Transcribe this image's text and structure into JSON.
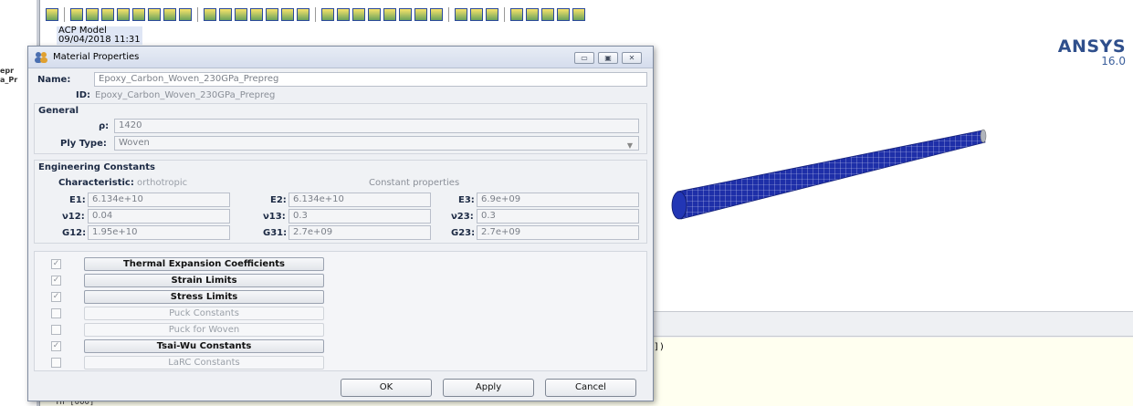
{
  "background": {
    "left_stub_lines": [
      "epr",
      "a_Pr"
    ],
    "viewport_info": {
      "model_name": "ACP Model",
      "timestamp": "09/04/2018 11:31"
    },
    "brand": {
      "name": "ANSYS",
      "version": "16.0"
    },
    "console_snippet": "])",
    "console_bottom": "Tn   [000]"
  },
  "dialog": {
    "title": "Material Properties",
    "name_label": "Name:",
    "name_value": "Epoxy_Carbon_Woven_230GPa_Prepreg",
    "id_label": "ID:",
    "id_value": "Epoxy_Carbon_Woven_230GPa_Prepreg",
    "general": {
      "title": "General",
      "rho_label": "ρ:",
      "rho_value": "1420",
      "ply_type_label": "Ply Type:",
      "ply_type_value": "Woven"
    },
    "engineering": {
      "title": "Engineering Constants",
      "characteristic_label": "Characteristic:",
      "characteristic_value": "orthotropic",
      "constant_properties_label": "Constant properties",
      "e1_label": "E1:",
      "e1_value": "6.134e+10",
      "e2_label": "E2:",
      "e2_value": "6.134e+10",
      "e3_label": "E3:",
      "e3_value": "6.9e+09",
      "v12_label": "ν12:",
      "v12_value": "0.04",
      "v13_label": "ν13:",
      "v13_value": "0.3",
      "v23_label": "ν23:",
      "v23_value": "0.3",
      "g12_label": "G12:",
      "g12_value": "1.95e+10",
      "g31_label": "G31:",
      "g31_value": "2.7e+09",
      "g23_label": "G23:",
      "g23_value": "2.7e+09"
    },
    "property_sets": [
      {
        "label": "Thermal Expansion Coefficients",
        "checked": true,
        "enabled": true
      },
      {
        "label": "Strain Limits",
        "checked": true,
        "enabled": true
      },
      {
        "label": "Stress Limits",
        "checked": true,
        "enabled": true
      },
      {
        "label": "Puck Constants",
        "checked": false,
        "enabled": false
      },
      {
        "label": "Puck for Woven",
        "checked": false,
        "enabled": false
      },
      {
        "label": "Tsai-Wu Constants",
        "checked": true,
        "enabled": true
      },
      {
        "label": "LaRC Constants",
        "checked": false,
        "enabled": false
      }
    ],
    "buttons": {
      "ok": "OK",
      "apply": "Apply",
      "cancel": "Cancel"
    },
    "check_glyph": "✓",
    "window_controls": {
      "minimize": "▭",
      "maximize": "▣",
      "close": "✕"
    },
    "combo_caret": "▼"
  },
  "colors": {
    "tube_mesh": "#1e2fa8",
    "tube_end": "#b0b4bc",
    "ansys_blue": "#2f4f8c"
  }
}
